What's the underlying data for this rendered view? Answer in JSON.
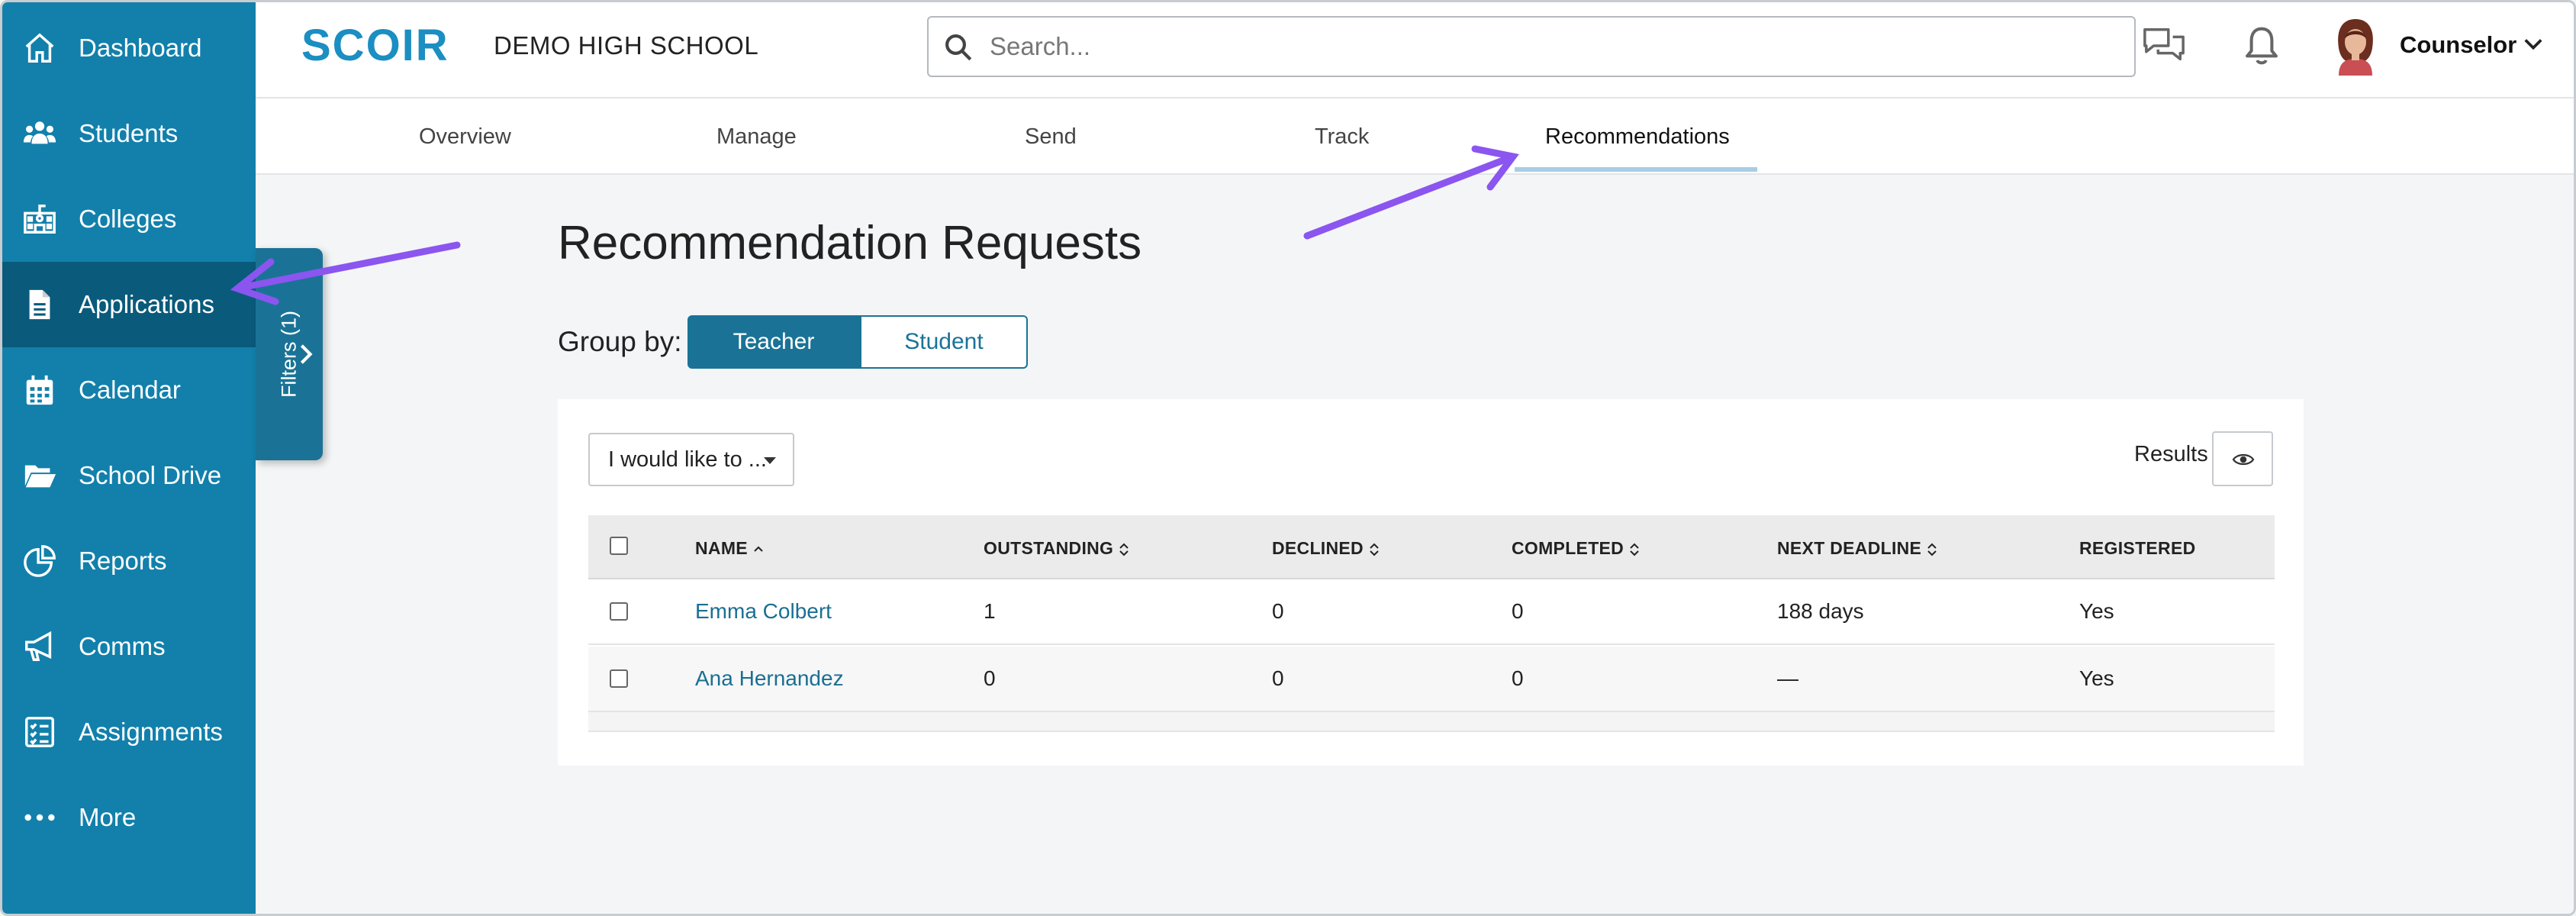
{
  "sidebar": {
    "items": [
      {
        "label": "Dashboard",
        "icon": "home-icon"
      },
      {
        "label": "Students",
        "icon": "users-icon"
      },
      {
        "label": "Colleges",
        "icon": "school-icon"
      },
      {
        "label": "Applications",
        "icon": "document-icon"
      },
      {
        "label": "Calendar",
        "icon": "calendar-icon"
      },
      {
        "label": "School Drive",
        "icon": "folder-icon"
      },
      {
        "label": "Reports",
        "icon": "pie-chart-icon"
      },
      {
        "label": "Comms",
        "icon": "megaphone-icon"
      },
      {
        "label": "Assignments",
        "icon": "checklist-icon"
      },
      {
        "label": "More",
        "icon": "ellipsis-icon"
      }
    ],
    "active_index": 3,
    "filters_tab": "Filters (1)"
  },
  "header": {
    "logo_text": "SCOIR",
    "school_name": "DEMO HIGH SCHOOL",
    "search_placeholder": "Search...",
    "user_label": "Counselor"
  },
  "tabs": {
    "items": [
      "Overview",
      "Manage",
      "Send",
      "Track",
      "Recommendations"
    ],
    "active": "Recommendations"
  },
  "main": {
    "title": "Recommendation Requests",
    "group_by_label": "Group by:",
    "group_by_options": [
      "Teacher",
      "Student"
    ],
    "group_by_selected": "Teacher",
    "action_dropdown": "I would like to ...",
    "results_label": "Results",
    "table": {
      "headers": [
        "NAME",
        "OUTSTANDING",
        "DECLINED",
        "COMPLETED",
        "NEXT DEADLINE",
        "REGISTERED"
      ],
      "rows": [
        {
          "name": "Emma Colbert",
          "outstanding": "1",
          "declined": "0",
          "completed": "0",
          "next_deadline": "188 days",
          "registered": "Yes"
        },
        {
          "name": "Ana Hernandez",
          "outstanding": "0",
          "declined": "0",
          "completed": "0",
          "next_deadline": "—",
          "registered": "Yes"
        }
      ]
    }
  },
  "colors": {
    "sidebar": "#1280ab",
    "sidebar_active": "#0a5a7b",
    "primary": "#1a7396",
    "annotation_arrow": "#8b55f0"
  }
}
